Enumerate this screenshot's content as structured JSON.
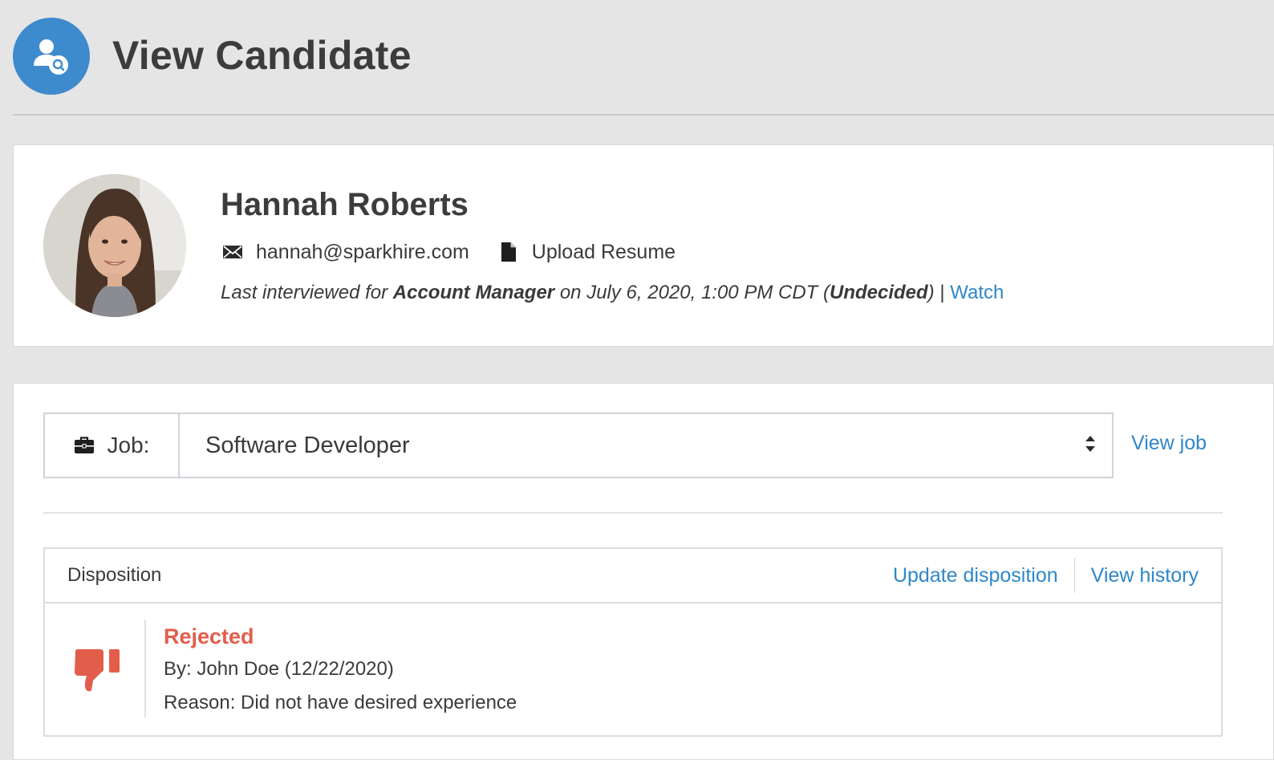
{
  "page": {
    "title": "View Candidate"
  },
  "candidate": {
    "name": "Hannah Roberts",
    "email": "hannah@sparkhire.com",
    "resume_label": "Upload Resume",
    "interview": {
      "prefix": "Last interviewed for ",
      "position": "Account Manager",
      "middle": " on July 6, 2020, 1:00 PM CDT (",
      "result": "Undecided",
      "suffix": ")",
      "separator": " | ",
      "watch_label": "Watch"
    }
  },
  "job": {
    "label": "Job:",
    "selected": "Software Developer",
    "view_job_label": "View job"
  },
  "disposition": {
    "title": "Disposition",
    "update_label": "Update disposition",
    "history_label": "View history",
    "status": "Rejected",
    "by": "By: John Doe (12/22/2020)",
    "reason": "Reason: Did not have desired experience"
  },
  "colors": {
    "accent": "#3d8bcd",
    "link": "#2f87c8",
    "rejected": "#e35d4b"
  },
  "icons": {
    "header": "user-search-icon",
    "email": "envelope-icon",
    "resume": "file-icon",
    "job": "briefcase-icon",
    "select": "sort-arrows-icon",
    "disposition": "thumbs-down-icon"
  }
}
